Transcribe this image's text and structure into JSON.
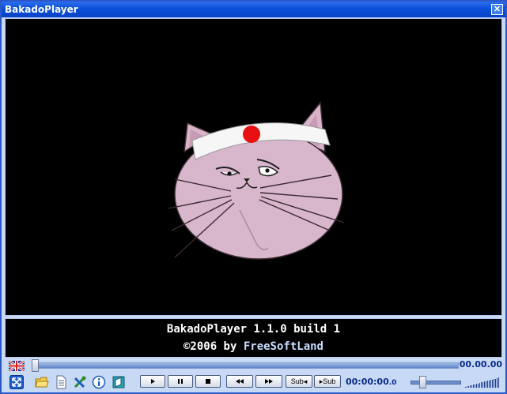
{
  "window": {
    "title": "BakadoPlayer",
    "close_glyph": "✕"
  },
  "video": {
    "content": "cartoon-cat-headband-image"
  },
  "info": {
    "line1": "BakadoPlayer 1.1.0 build 1",
    "line2_prefix": "©2006 by ",
    "line2_brand": "FreeSoftLand"
  },
  "seek": {
    "total_time": "00.00.00",
    "position_fraction": 0
  },
  "controls": {
    "icons": [
      "fullscreen-icon",
      "open-folder-icon",
      "playlist-icon",
      "settings-icon",
      "info-icon",
      "skin-icon"
    ],
    "sub_prev_label": "Sub◂",
    "sub_next_label": "▸Sub",
    "current_time_main": "00:00:00",
    "current_time_frac": ".0",
    "volume_fraction": 0.2
  },
  "colors": {
    "title_bar": "#0a4fd8",
    "frame": "#c7d9f5",
    "time_text": "#0a2a8a"
  }
}
